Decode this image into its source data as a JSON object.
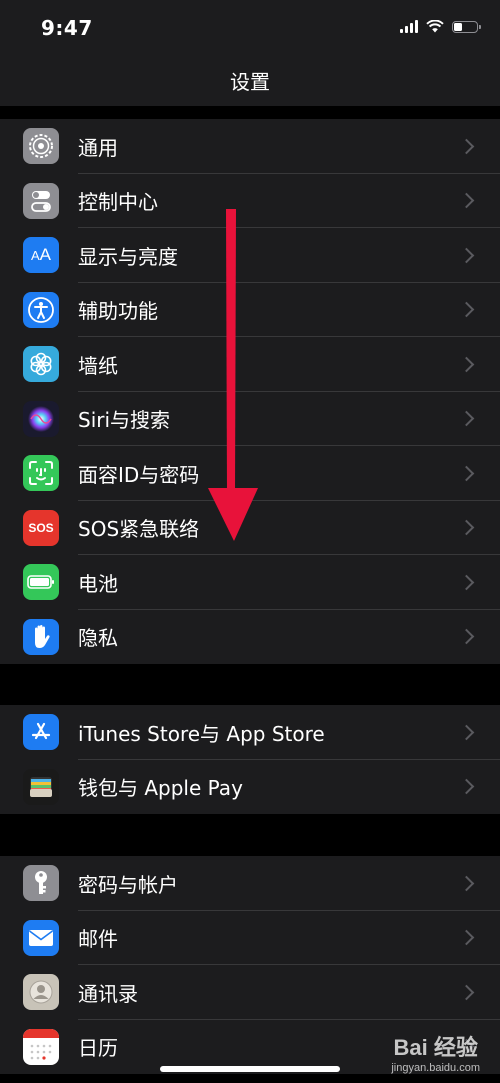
{
  "status_bar": {
    "time": "9:47"
  },
  "nav": {
    "title": "设置"
  },
  "groups": [
    {
      "items": [
        {
          "label": "通用",
          "icon": "gear-icon",
          "color": "#8e8e93"
        },
        {
          "label": "控制中心",
          "icon": "toggles-icon",
          "color": "#8e8e93"
        },
        {
          "label": "显示与亮度",
          "icon": "text-size-icon",
          "color": "#1e7cf2"
        },
        {
          "label": "辅助功能",
          "icon": "accessibility-icon",
          "color": "#1e7cf2"
        },
        {
          "label": "墙纸",
          "icon": "flower-icon",
          "color": "#36aadc"
        },
        {
          "label": "Siri与搜索",
          "icon": "siri-icon",
          "color": "#1a1a2e"
        },
        {
          "label": "面容ID与密码",
          "icon": "face-id-icon",
          "color": "#34c759"
        },
        {
          "label": "SOS紧急联络",
          "icon": "sos-icon",
          "color": "#e5352c"
        },
        {
          "label": "电池",
          "icon": "battery-icon",
          "color": "#34c759"
        },
        {
          "label": "隐私",
          "icon": "hand-icon",
          "color": "#1e7cf2"
        }
      ]
    },
    {
      "items": [
        {
          "label": "iTunes Store与 App Store",
          "icon": "app-store-icon",
          "color": "#1e7cf2"
        },
        {
          "label": "钱包与 Apple Pay",
          "icon": "wallet-icon",
          "color": "#1a1a1a"
        }
      ]
    },
    {
      "items": [
        {
          "label": "密码与帐户",
          "icon": "key-icon",
          "color": "#8e8e93"
        },
        {
          "label": "邮件",
          "icon": "mail-icon",
          "color": "#1e7cf2"
        },
        {
          "label": "通讯录",
          "icon": "contacts-icon",
          "color": "#c8c3b8"
        },
        {
          "label": "日历",
          "icon": "calendar-icon",
          "color": "#ffffff"
        }
      ]
    }
  ],
  "watermark": {
    "main": "Bai 经验",
    "sub": "jingyan.baidu.com"
  }
}
